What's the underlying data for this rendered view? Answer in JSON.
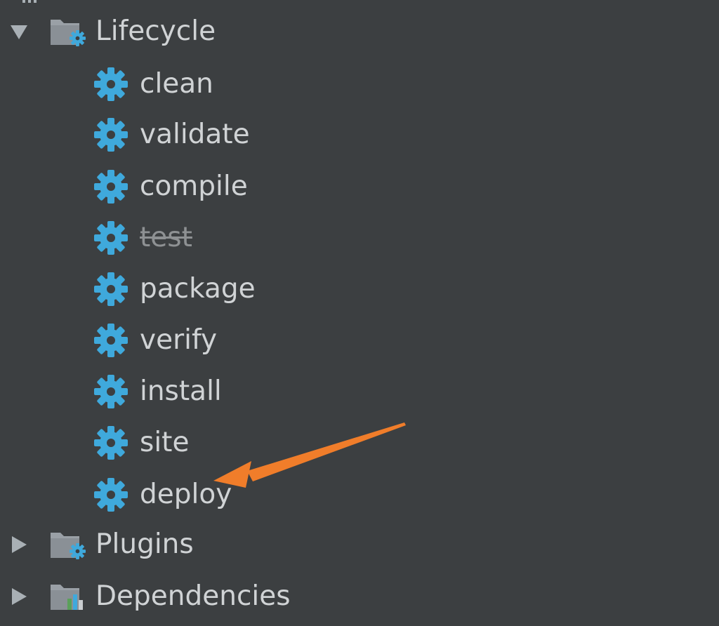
{
  "tree": {
    "lifecycle": {
      "label": "Lifecycle",
      "expanded": true,
      "icon": "folder-gear-icon",
      "goals": [
        {
          "label": "clean",
          "icon": "gear-icon",
          "disabled": false
        },
        {
          "label": "validate",
          "icon": "gear-icon",
          "disabled": false
        },
        {
          "label": "compile",
          "icon": "gear-icon",
          "disabled": false
        },
        {
          "label": "test",
          "icon": "gear-icon",
          "disabled": true
        },
        {
          "label": "package",
          "icon": "gear-icon",
          "disabled": false
        },
        {
          "label": "verify",
          "icon": "gear-icon",
          "disabled": false
        },
        {
          "label": "install",
          "icon": "gear-icon",
          "disabled": false
        },
        {
          "label": "site",
          "icon": "gear-icon",
          "disabled": false
        },
        {
          "label": "deploy",
          "icon": "gear-icon",
          "disabled": false
        }
      ]
    },
    "plugins": {
      "label": "Plugins",
      "expanded": false,
      "icon": "folder-gear-icon"
    },
    "dependencies": {
      "label": "Dependencies",
      "expanded": false,
      "icon": "folder-chart-icon"
    }
  },
  "colors": {
    "background": "#3c3f41",
    "text": "#d0d3d5",
    "gear": "#3fa9dc",
    "folder": "#9aa0a6",
    "toggle": "#a9b0b5",
    "annotation_arrow": "#f07d2a"
  }
}
